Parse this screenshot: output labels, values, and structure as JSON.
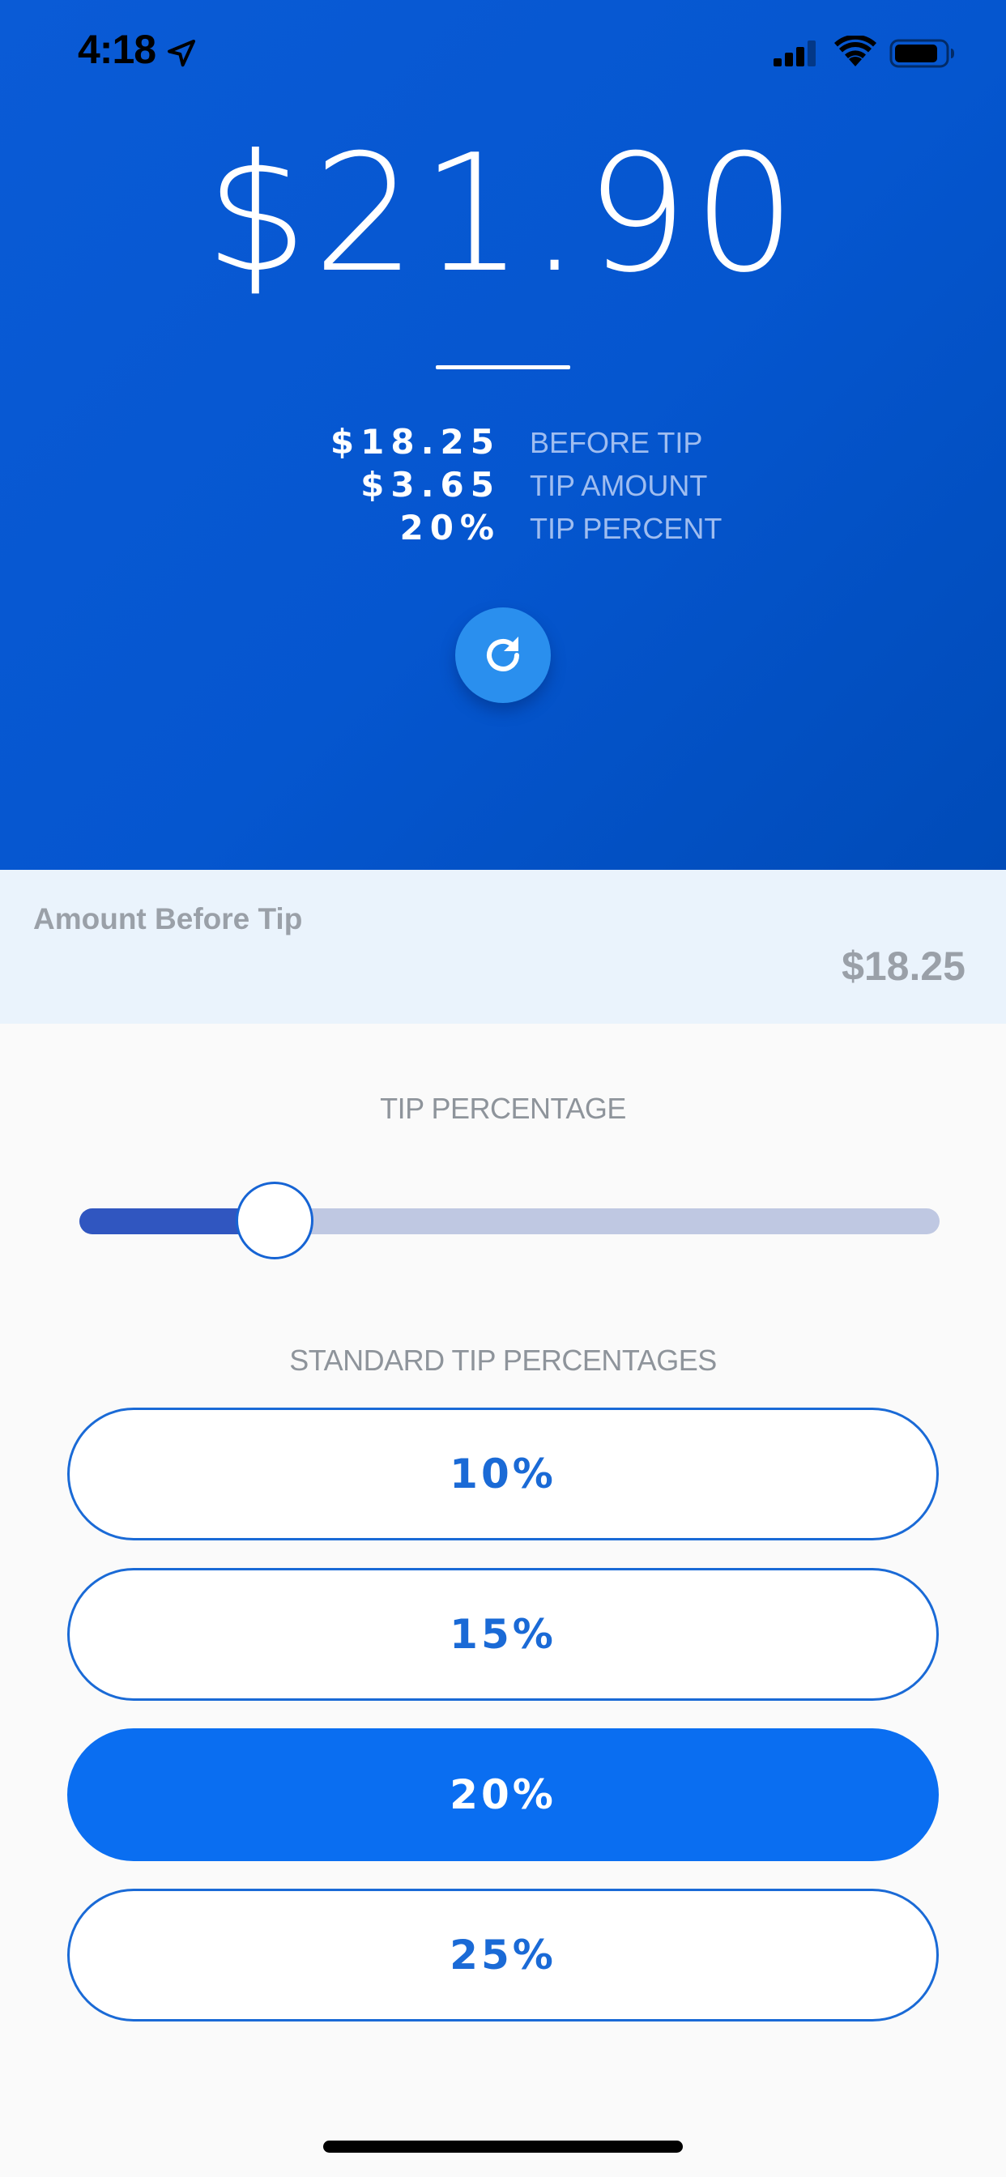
{
  "status_bar": {
    "time": "4:18",
    "icons": [
      "location-arrow-icon",
      "cellular-signal-icon",
      "wifi-icon",
      "battery-icon"
    ]
  },
  "header": {
    "total": "$21.90",
    "breakdown": [
      {
        "value": "$18.25",
        "label": "BEFORE TIP"
      },
      {
        "value": "$3.65",
        "label": "TIP AMOUNT"
      },
      {
        "value": "20%",
        "label": "TIP PERCENT"
      }
    ],
    "refresh_icon": "refresh-icon"
  },
  "amount_input": {
    "label": "Amount Before Tip",
    "value": "$18.25"
  },
  "tip_slider": {
    "title": "TIP PERCENTAGE",
    "value_fraction": 0.2
  },
  "standard_tips": {
    "title": "STANDARD TIP PERCENTAGES",
    "options": [
      "10%",
      "15%",
      "20%",
      "25%"
    ],
    "selected": "20%"
  },
  "colors": {
    "header_blue": "#0556cf",
    "accent_blue": "#0a6ef1",
    "outline_blue": "#1a6ad6",
    "slider_fill": "#3056c0",
    "slider_track": "#bfc8e2",
    "amount_bg": "#eaf3fc"
  }
}
